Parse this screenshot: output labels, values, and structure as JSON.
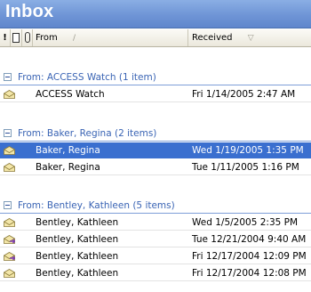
{
  "window": {
    "title": "Inbox"
  },
  "columns": {
    "importance": "!",
    "from": "From",
    "received": "Received"
  },
  "groups": [
    {
      "label": "From: ACCESS Watch (1 item)",
      "rows": [
        {
          "from": "ACCESS Watch",
          "received": "Fri 1/14/2005 2:47 AM",
          "icon": "envelope-open-icon",
          "selected": false
        }
      ]
    },
    {
      "label": "From: Baker, Regina (2 items)",
      "rows": [
        {
          "from": "Baker, Regina",
          "received": "Wed 1/19/2005 1:35 PM",
          "icon": "envelope-open-icon",
          "selected": true
        },
        {
          "from": "Baker, Regina",
          "received": "Tue 1/11/2005 1:16 PM",
          "icon": "envelope-open-icon",
          "selected": false
        }
      ]
    },
    {
      "label": "From: Bentley, Kathleen (5 items)",
      "rows": [
        {
          "from": "Bentley, Kathleen",
          "received": "Wed 1/5/2005 2:35 PM",
          "icon": "envelope-open-icon",
          "selected": false
        },
        {
          "from": "Bentley, Kathleen",
          "received": "Tue 12/21/2004 9:40 AM",
          "icon": "envelope-replied-icon",
          "selected": false
        },
        {
          "from": "Bentley, Kathleen",
          "received": "Fri 12/17/2004 12:09 PM",
          "icon": "envelope-replied-icon",
          "selected": false
        },
        {
          "from": "Bentley, Kathleen",
          "received": "Fri 12/17/2004 12:08 PM",
          "icon": "envelope-open-icon",
          "selected": false
        }
      ]
    }
  ],
  "colors": {
    "title_bar": "#6f95d6",
    "group_label": "#3a64b4",
    "selection": "#3a6fcf"
  }
}
